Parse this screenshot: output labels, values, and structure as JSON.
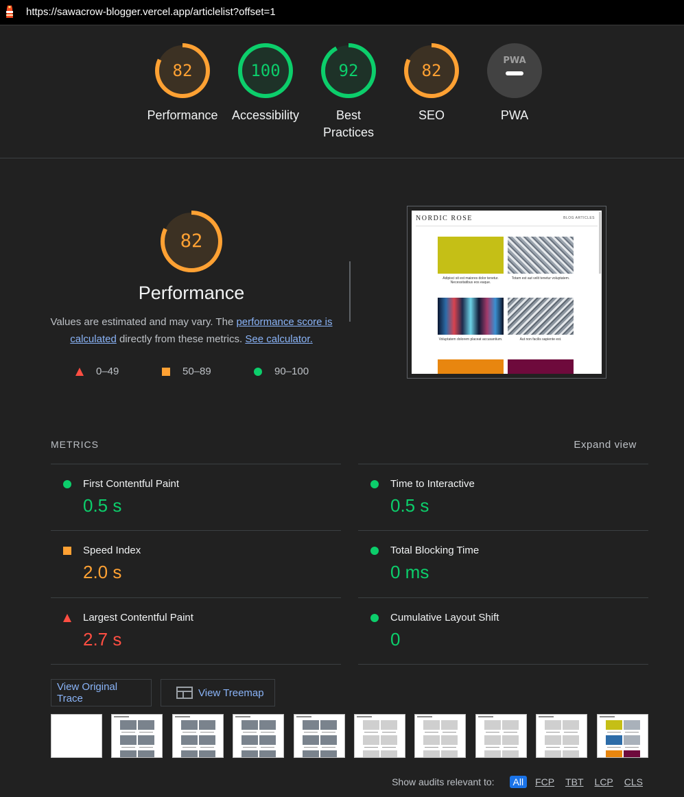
{
  "browser": {
    "url": "https://sawacrow-blogger.vercel.app/articlelist?offset=1",
    "logo_icon": "lighthouse-icon"
  },
  "colors": {
    "average": "#ffa133",
    "pass": "#0cce6b",
    "fail": "#ff4e42",
    "link": "#8ab4f8",
    "pwa_grey": "#5f6368"
  },
  "gauges": [
    {
      "id": "performance",
      "score": "82",
      "label": "Performance",
      "status": "average",
      "fraction": 0.82
    },
    {
      "id": "accessibility",
      "score": "100",
      "label": "Accessibility",
      "status": "pass",
      "fraction": 1.0
    },
    {
      "id": "best-practices",
      "score": "92",
      "label_lines": [
        "Best",
        "Practices"
      ],
      "status": "pass",
      "fraction": 0.92
    },
    {
      "id": "seo",
      "score": "82",
      "label": "SEO",
      "status": "average",
      "fraction": 0.82
    },
    {
      "id": "pwa",
      "badge": "PWA",
      "label": "PWA",
      "status": "na"
    }
  ],
  "performance": {
    "score": "82",
    "fraction": 0.82,
    "title": "Performance",
    "desc_part1": "Values are estimated and may vary. The ",
    "desc_link1": "performance score is calculated",
    "desc_part2": " directly from these metrics. ",
    "desc_link2": "See calculator.",
    "legend": [
      {
        "range": "0–49",
        "shape": "triangle"
      },
      {
        "range": "50–89",
        "shape": "square"
      },
      {
        "range": "90–100",
        "shape": "circle"
      }
    ]
  },
  "screenshot": {
    "brand": "NORDIC ROSE",
    "nav": "BLOG    ARTICLES",
    "captions": [
      "Adipisci sit est maiores dolor tenetur. Necessitatibus eos eaque.",
      "Totam est aut velit tenetur voluptatem.",
      "Voluptatem dolorem placeat accusantium.",
      "Aut non facilis sapiente est."
    ]
  },
  "metrics": {
    "title": "METRICS",
    "expand_label": "Expand view",
    "items": [
      {
        "name": "First Contentful Paint",
        "value": "0.5 s",
        "status": "pass"
      },
      {
        "name": "Time to Interactive",
        "value": "0.5 s",
        "status": "pass"
      },
      {
        "name": "Speed Index",
        "value": "2.0 s",
        "status": "average"
      },
      {
        "name": "Total Blocking Time",
        "value": "0 ms",
        "status": "pass"
      },
      {
        "name": "Largest Contentful Paint",
        "value": "2.7 s",
        "status": "fail"
      },
      {
        "name": "Cumulative Layout Shift",
        "value": "0",
        "status": "pass"
      }
    ]
  },
  "buttons": {
    "view_trace": "View Original Trace",
    "view_treemap": "View Treemap",
    "treemap_icon": "treemap-icon"
  },
  "filmstrip": {
    "frame_count": 10
  },
  "audits_filter": {
    "label": "Show audits relevant to:",
    "chips": [
      "All",
      "FCP",
      "TBT",
      "LCP",
      "CLS"
    ],
    "active": "All"
  }
}
